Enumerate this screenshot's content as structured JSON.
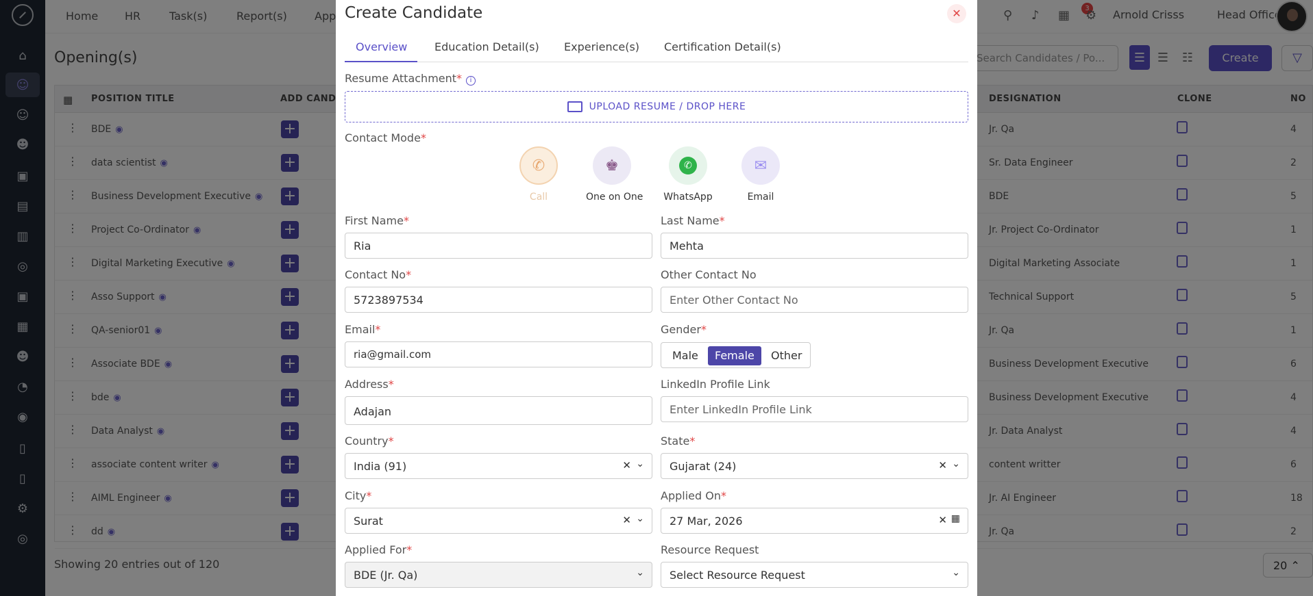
{
  "topbar": {
    "nav": [
      "Home",
      "HR",
      "Task(s)",
      "Report(s)",
      "App"
    ],
    "user_name": "Arnold Crisss",
    "location": "Head Office",
    "notification_count": "3"
  },
  "page": {
    "title": "Opening(s)",
    "search_placeholder": "Search Candidates / Po...",
    "create_label": "Create",
    "footer": "Showing 20 entries out of 120",
    "page_size": "20"
  },
  "table": {
    "headers": [
      "POSITION TITLE",
      "ADD CANDI",
      "DESIGNATION",
      "CLONE",
      "NO"
    ],
    "rows": [
      {
        "title": "BDE",
        "designation": "Jr. Qa",
        "no": "4"
      },
      {
        "title": "data scientist",
        "designation": "Sr. Data Engineer",
        "no": "2"
      },
      {
        "title": "Business Development Executive",
        "designation": "BDE",
        "no": "5"
      },
      {
        "title": "Project Co-Ordinator",
        "designation": "Jr. Project Co-Ordinator",
        "no": "1"
      },
      {
        "title": "Digital Marketing Executive",
        "designation": "Digital Marketing Associate",
        "no": "1"
      },
      {
        "title": "Asso Support",
        "designation": "Technical Support",
        "no": "5"
      },
      {
        "title": "QA-senior01",
        "designation": "Jr. Qa",
        "no": "1"
      },
      {
        "title": "Associate BDE",
        "designation": "Business Development Executive",
        "no": "6"
      },
      {
        "title": "bde",
        "designation": "Business Development Executive",
        "no": "4"
      },
      {
        "title": "Data Analyst",
        "designation": "Jr. Data Analyst",
        "no": "4"
      },
      {
        "title": "associate content writer",
        "designation": "content writter",
        "no": "6"
      },
      {
        "title": "AIML Engineer",
        "designation": "Jr. AI Engineer",
        "no": "18"
      },
      {
        "title": "dd",
        "designation": "Jr. Qa",
        "no": "2"
      }
    ]
  },
  "modal": {
    "title": "Create Candidate",
    "tabs": [
      "Overview",
      "Education Detail(s)",
      "Experience(s)",
      "Certification Detail(s)"
    ],
    "resume_label": "Resume Attachment",
    "upload_text": "UPLOAD RESUME / DROP HERE",
    "contact_mode_label": "Contact Mode",
    "contact_modes": [
      "Call",
      "One on One",
      "WhatsApp",
      "Email"
    ],
    "fields": {
      "first_name": {
        "label": "First Name",
        "value": "Ria"
      },
      "last_name": {
        "label": "Last Name",
        "value": "Mehta"
      },
      "contact_no": {
        "label": "Contact No",
        "value": "5723897534"
      },
      "other_contact": {
        "label": "Other Contact No",
        "placeholder": "Enter Other Contact No"
      },
      "email": {
        "label": "Email",
        "value": "ria@gmail.com"
      },
      "gender": {
        "label": "Gender",
        "options": [
          "Male",
          "Female",
          "Other"
        ],
        "selected": "Female"
      },
      "address": {
        "label": "Address",
        "value": "Adajan"
      },
      "linkedin": {
        "label": "LinkedIn Profile Link",
        "placeholder": "Enter LinkedIn Profile Link"
      },
      "country": {
        "label": "Country",
        "value": "India (91)"
      },
      "state": {
        "label": "State",
        "value": "Gujarat (24)"
      },
      "city": {
        "label": "City",
        "value": "Surat"
      },
      "applied_on": {
        "label": "Applied On",
        "value": "27 Mar, 2026"
      },
      "applied_for": {
        "label": "Applied For",
        "value": "BDE (Jr. Qa)"
      },
      "resource_request": {
        "label": "Resource Request",
        "placeholder": "Select Resource Request"
      }
    },
    "required_mark": "*"
  },
  "colors": {
    "accent": "#5a50c8",
    "sidebar": "#1f2733",
    "danger": "#e04545"
  }
}
